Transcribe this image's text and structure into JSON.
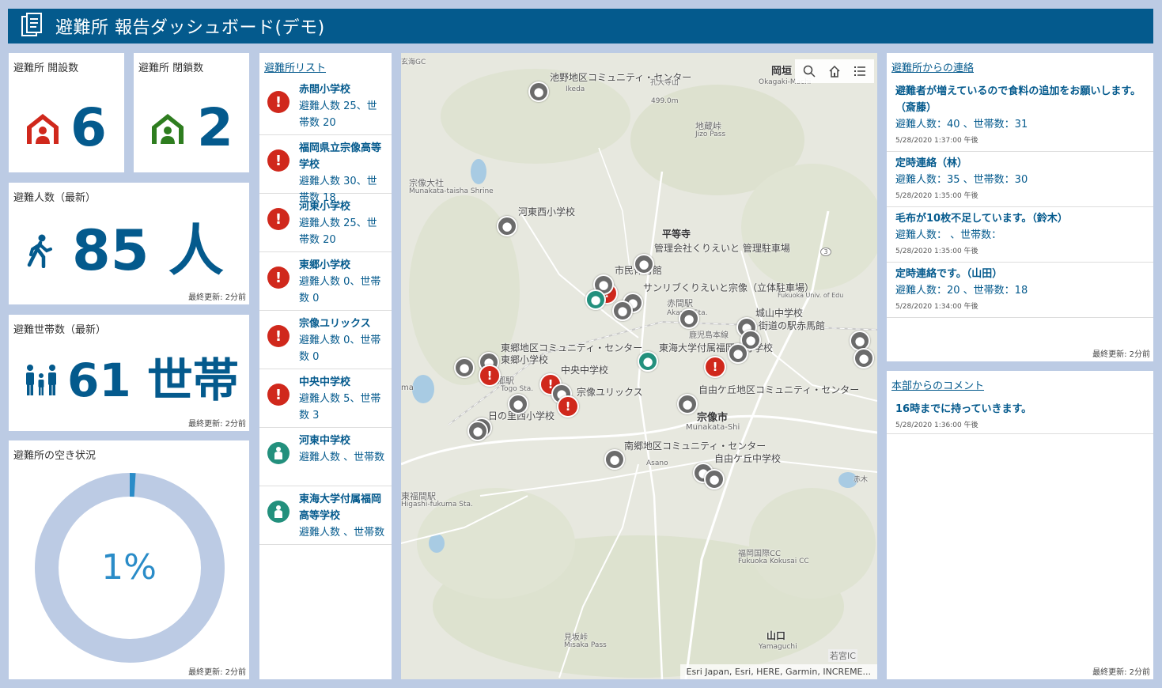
{
  "header": {
    "title": "避難所 報告ダッシュボード(デモ)"
  },
  "indicators": {
    "open": {
      "title": "避難所 開設数",
      "value": "6"
    },
    "closed": {
      "title": "避難所 閉鎖数",
      "value": "2"
    },
    "people": {
      "title": "避難人数（最新）",
      "value": "85 人",
      "updated": "最終更新: 2分前"
    },
    "households": {
      "title": "避難世帯数（最新）",
      "value": "61 世帯",
      "updated": "最終更新: 2分前"
    }
  },
  "gauge": {
    "title": "避難所の空き状況",
    "label": "1%",
    "percent": 1,
    "updated": "最終更新: 2分前"
  },
  "shelter_list": {
    "title": "避難所リスト",
    "items": [
      {
        "name": "赤間小学校",
        "desc": "避難人数 25、世帯数 20",
        "status": "alert"
      },
      {
        "name": "福岡県立宗像高等学校",
        "desc": "避難人数 30、世帯数 18",
        "status": "alert"
      },
      {
        "name": "河東小学校",
        "desc": "避難人数 25、世帯数 20",
        "status": "alert"
      },
      {
        "name": "東郷小学校",
        "desc": "避難人数 0、世帯数 0",
        "status": "alert"
      },
      {
        "name": "宗像ユリックス",
        "desc": "避難人数 0、世帯数 0",
        "status": "alert"
      },
      {
        "name": "中央中学校",
        "desc": "避難人数 5、世帯数 3",
        "status": "alert"
      },
      {
        "name": "河東中学校",
        "desc": "避難人数 、世帯数",
        "status": "ok"
      },
      {
        "name": "東海大学付属福岡高等学校",
        "desc": "避難人数 、世帯数",
        "status": "ok"
      }
    ]
  },
  "map": {
    "labels": {
      "l1": "池野地区コミュニティ・センター",
      "l2": "孔大寺山",
      "l3": "499.0m",
      "l4": "Ikeda",
      "l5": "岡垣",
      "l6": "Okagaki-Machi",
      "l7": "地蔵峠",
      "l8": "Jizo Pass",
      "l9": "宗像大社",
      "l10": "Munakata-taisha Shrine",
      "l11": "河東西小学校",
      "l12": "平等寺",
      "l13": "管理会社くりえいと 管理駐車場",
      "l14": "市民体育館",
      "l15": "サンリブくりえいと宗像（立体駐車場）",
      "l16": "赤間駅",
      "l17": "Akama Sta.",
      "l18": "鹿児島本線",
      "l19": "城山中学校",
      "l20": "街道の駅赤馬館",
      "l21": "東郷地区コミュニティ・センター",
      "l22": "東郷小学校",
      "l23": "東海大学付属福岡高等学校",
      "l24": "中央中学校",
      "l25": "宗像ユリックス",
      "l26": "自由ケ丘地区コミュニティ・センター",
      "l27": "東郷駅",
      "l28": "Togo Sta.",
      "l29": "日の里西小学校",
      "l30": "宗像市",
      "l31": "Munakata-Shi",
      "l32": "南郷地区コミュニティ・センター",
      "l33": "自由ケ丘中学校",
      "l34": "Asano",
      "l35": "東福間駅",
      "l36": "Higashi-fukuma Sta.",
      "l37": "福岡国際CC",
      "l38": "Fukuoka Kokusai CC",
      "l39": "見坂峠",
      "l40": "Misaka Pass",
      "l41": "山口",
      "l42": "Yamaguchi",
      "l43": "若宮IC",
      "l44": "赤木",
      "l45": "玄海GC",
      "l46": "Fukuoka Univ. of Edu",
      "l47": "3",
      "l48": "ma"
    },
    "attribution": "Esri Japan, Esri, HERE, Garmin, INCREME..."
  },
  "messages": {
    "title": "避難所からの連絡",
    "items": [
      {
        "title": "避難者が増えているので食料の追加をお願いします。（斎藤）",
        "body": "避難人数：40 、世帯数：31",
        "time": "5/28/2020 1:37:00 午後"
      },
      {
        "title": "定時連絡（林）",
        "body": "避難人数：35 、世帯数：30",
        "time": "5/28/2020 1:35:00 午後"
      },
      {
        "title": "毛布が10枚不足しています。（鈴木）",
        "body": "避難人数： 、世帯数：",
        "time": "5/28/2020 1:35:00 午後"
      },
      {
        "title": "定時連絡です。（山田）",
        "body": "避難人数：20 、世帯数：18",
        "time": "5/28/2020 1:34:00 午後"
      }
    ],
    "updated": "最終更新: 2分前"
  },
  "comments": {
    "title": "本部からのコメント",
    "items": [
      {
        "title": "16時までに持っていきます。",
        "time": "5/28/2020 1:36:00 午後"
      }
    ],
    "updated": "最終更新: 2分前"
  },
  "colors": {
    "brand": "#045a8d",
    "alert": "#d0281c",
    "ok": "#23907d",
    "closed": "#2e7d1f",
    "gauge_track": "#bccbe4",
    "gauge_fill": "#2a8cc8"
  }
}
